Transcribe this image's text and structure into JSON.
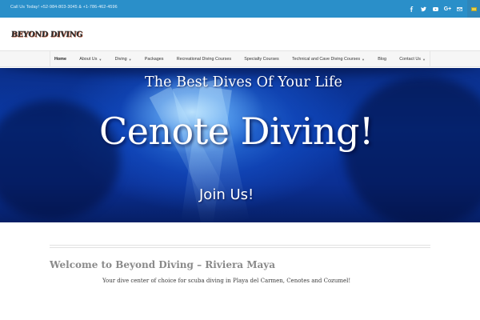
{
  "topbar": {
    "phone": "Call Us Today! +52-984-803-3045 & +1-786-462-4596",
    "social_icons": [
      "facebook-icon",
      "twitter-icon",
      "youtube-icon",
      "google-plus-icon",
      "email-icon",
      "language-flag-icon"
    ],
    "google_plus_label": "G+"
  },
  "header": {
    "logo_text": "BEYOND DIVING"
  },
  "nav": {
    "items": [
      {
        "label": "Home",
        "dropdown": false,
        "active": true
      },
      {
        "label": "About Us",
        "dropdown": true
      },
      {
        "label": "Diving",
        "dropdown": true
      },
      {
        "label": "Packages",
        "dropdown": false
      },
      {
        "label": "Recreational Diving Courses",
        "dropdown": false
      },
      {
        "label": "Specialty Courses",
        "dropdown": false
      },
      {
        "label": "Technical and Cave Diving Courses",
        "dropdown": true
      },
      {
        "label": "Blog",
        "dropdown": false
      },
      {
        "label": "Contact Us",
        "dropdown": true
      }
    ]
  },
  "hero": {
    "subtitle": "The Best Dives Of Your Life",
    "title": "Cenote Diving!",
    "cta": "Join Us!"
  },
  "content": {
    "welcome": "Welcome to Beyond Diving – Riviera Maya",
    "tagline": "Your dive center of choice  for scuba diving in Playa del Carmen, Cenotes and Cozumel!"
  },
  "colors": {
    "topbar": "#2a8fc9",
    "hero_deep": "#0a3aa8",
    "hero_light": "#c8ebff",
    "welcome_text": "#8a8a8a"
  }
}
